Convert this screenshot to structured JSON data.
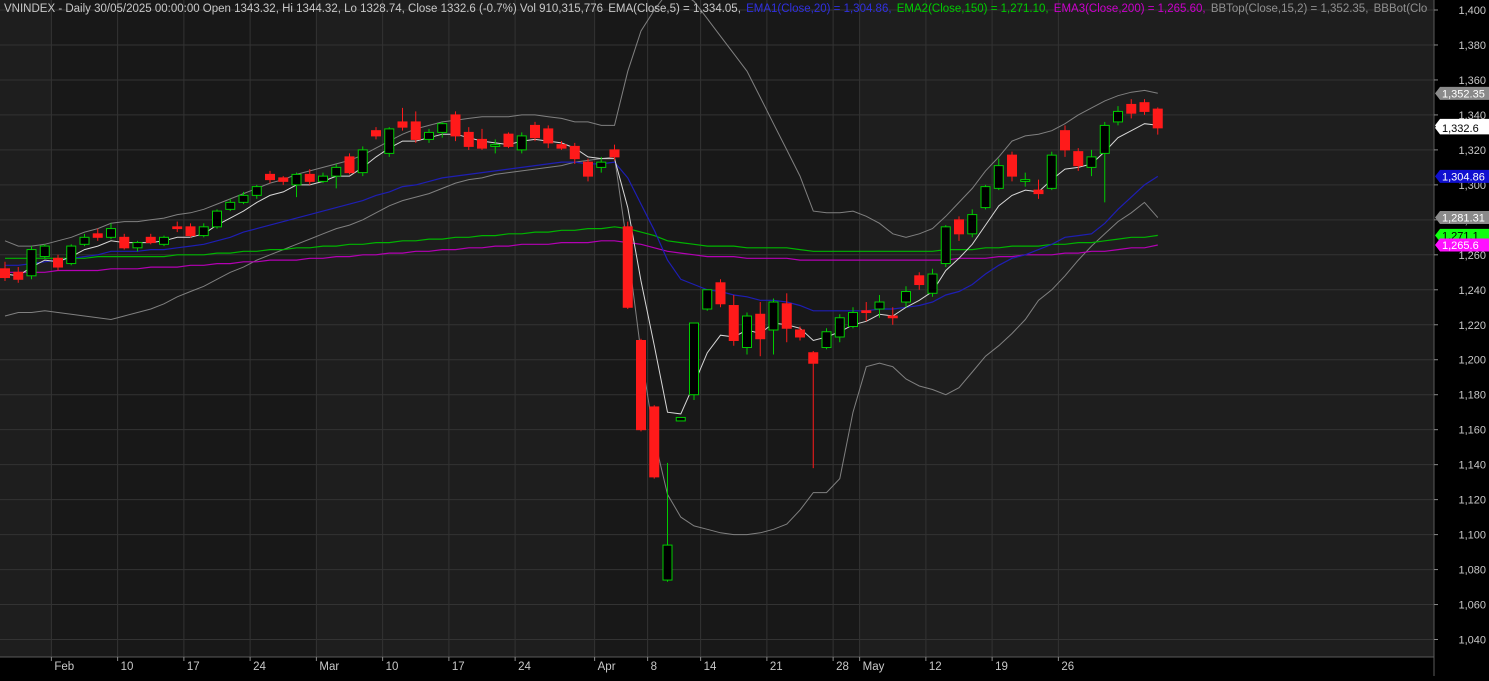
{
  "chart_data": {
    "type": "candlestick",
    "header": {
      "ticker_line": "VNINDEX - Daily 30/05/2025 00:00:00 Open 1343.32, Hi 1344.32, Lo 1328.74, Close 1332.6 (-0.7%) Vol 910,315,776",
      "ema": "EMA(Close,5) = 1,334.05,",
      "ema1": "EMA1(Close,20) = 1,304.86,",
      "ema2": "EMA2(Close,150) = 1,271.10,",
      "ema3": "EMA3(Close,200) = 1,265.60,",
      "bbtop": "BBTop(Close,15,2) = 1,352.35,",
      "bbbot": "BBBot(Clo"
    },
    "colors": {
      "background": "#000000",
      "panel_dark": "#181818",
      "panel_light": "#1e1e1e",
      "grid": "#333333",
      "up": "#00cc00",
      "down": "#ff1a1a",
      "ema": "#d8d8d8",
      "ema1": "#1e1eb4",
      "ema2": "#00b400",
      "ema3": "#b400b4",
      "bb": "#808080",
      "axis_text": "#c8c8c8"
    },
    "ylim": [
      1030,
      1400
    ],
    "y_ticks": [
      1040,
      1060,
      1080,
      1100,
      1120,
      1140,
      1160,
      1180,
      1200,
      1220,
      1240,
      1260,
      1280,
      1300,
      1320,
      1340,
      1360,
      1380,
      1400
    ],
    "y_tick_labels": [
      "1,040",
      "1,060",
      "1,080",
      "1,100",
      "1,120",
      "1,140",
      "1,160",
      "1,180",
      "1,200",
      "1,220",
      "1,240",
      "1,260",
      "1,280",
      "1,300",
      "1,320",
      "1,340",
      "1,360",
      "1,380",
      "1,400"
    ],
    "x_labels": [
      {
        "i": 4,
        "label": "Feb"
      },
      {
        "i": 9,
        "label": "10"
      },
      {
        "i": 14,
        "label": "17"
      },
      {
        "i": 19,
        "label": "24"
      },
      {
        "i": 24,
        "label": "Mar"
      },
      {
        "i": 29,
        "label": "10"
      },
      {
        "i": 34,
        "label": "17"
      },
      {
        "i": 39,
        "label": "24"
      },
      {
        "i": 45,
        "label": "Apr"
      },
      {
        "i": 49,
        "label": "8"
      },
      {
        "i": 53,
        "label": "14"
      },
      {
        "i": 58,
        "label": "21"
      },
      {
        "i": 63,
        "label": "28"
      },
      {
        "i": 65,
        "label": "May"
      },
      {
        "i": 70,
        "label": "12"
      },
      {
        "i": 75,
        "label": "19"
      },
      {
        "i": 80,
        "label": "26"
      }
    ],
    "period_shading_starts": [
      4,
      24,
      45,
      65
    ],
    "candles": [
      {
        "o": 1252,
        "h": 1256,
        "l": 1245,
        "c": 1247
      },
      {
        "o": 1250,
        "h": 1253,
        "l": 1244,
        "c": 1246
      },
      {
        "o": 1248,
        "h": 1265,
        "l": 1246,
        "c": 1263
      },
      {
        "o": 1259,
        "h": 1266,
        "l": 1258,
        "c": 1265
      },
      {
        "o": 1258,
        "h": 1260,
        "l": 1251,
        "c": 1253
      },
      {
        "o": 1255,
        "h": 1266,
        "l": 1254,
        "c": 1265
      },
      {
        "o": 1266,
        "h": 1272,
        "l": 1265,
        "c": 1270
      },
      {
        "o": 1272,
        "h": 1275,
        "l": 1268,
        "c": 1270
      },
      {
        "o": 1270,
        "h": 1278,
        "l": 1269,
        "c": 1275
      },
      {
        "o": 1270,
        "h": 1272,
        "l": 1263,
        "c": 1264
      },
      {
        "o": 1264,
        "h": 1268,
        "l": 1262,
        "c": 1267
      },
      {
        "o": 1270,
        "h": 1272,
        "l": 1266,
        "c": 1267
      },
      {
        "o": 1266,
        "h": 1271,
        "l": 1265,
        "c": 1270
      },
      {
        "o": 1276,
        "h": 1279,
        "l": 1273,
        "c": 1275
      },
      {
        "o": 1276,
        "h": 1278,
        "l": 1270,
        "c": 1271
      },
      {
        "o": 1271,
        "h": 1278,
        "l": 1270,
        "c": 1276
      },
      {
        "o": 1276,
        "h": 1286,
        "l": 1275,
        "c": 1285
      },
      {
        "o": 1286,
        "h": 1292,
        "l": 1285,
        "c": 1290
      },
      {
        "o": 1290,
        "h": 1296,
        "l": 1289,
        "c": 1294
      },
      {
        "o": 1294,
        "h": 1300,
        "l": 1292,
        "c": 1299
      },
      {
        "o": 1306,
        "h": 1308,
        "l": 1301,
        "c": 1303
      },
      {
        "o": 1304,
        "h": 1305,
        "l": 1300,
        "c": 1302
      },
      {
        "o": 1300,
        "h": 1307,
        "l": 1293,
        "c": 1306
      },
      {
        "o": 1306,
        "h": 1309,
        "l": 1300,
        "c": 1302
      },
      {
        "o": 1302,
        "h": 1307,
        "l": 1301,
        "c": 1305
      },
      {
        "o": 1305,
        "h": 1312,
        "l": 1298,
        "c": 1310
      },
      {
        "o": 1316,
        "h": 1318,
        "l": 1306,
        "c": 1307
      },
      {
        "o": 1307,
        "h": 1322,
        "l": 1305,
        "c": 1320
      },
      {
        "o": 1331,
        "h": 1333,
        "l": 1326,
        "c": 1328
      },
      {
        "o": 1318,
        "h": 1333,
        "l": 1316,
        "c": 1332
      },
      {
        "o": 1336,
        "h": 1344,
        "l": 1331,
        "c": 1333
      },
      {
        "o": 1336,
        "h": 1342,
        "l": 1324,
        "c": 1326
      },
      {
        "o": 1326,
        "h": 1332,
        "l": 1324,
        "c": 1330
      },
      {
        "o": 1330,
        "h": 1336,
        "l": 1327,
        "c": 1335
      },
      {
        "o": 1340,
        "h": 1342,
        "l": 1325,
        "c": 1328
      },
      {
        "o": 1330,
        "h": 1333,
        "l": 1320,
        "c": 1322
      },
      {
        "o": 1326,
        "h": 1332,
        "l": 1320,
        "c": 1321
      },
      {
        "o": 1322,
        "h": 1326,
        "l": 1318,
        "c": 1323
      },
      {
        "o": 1329,
        "h": 1330,
        "l": 1321,
        "c": 1322
      },
      {
        "o": 1320,
        "h": 1330,
        "l": 1318,
        "c": 1328
      },
      {
        "o": 1334,
        "h": 1336,
        "l": 1325,
        "c": 1327
      },
      {
        "o": 1332,
        "h": 1334,
        "l": 1321,
        "c": 1324
      },
      {
        "o": 1323,
        "h": 1325,
        "l": 1320,
        "c": 1321
      },
      {
        "o": 1322,
        "h": 1324,
        "l": 1312,
        "c": 1315
      },
      {
        "o": 1313,
        "h": 1315,
        "l": 1302,
        "c": 1305
      },
      {
        "o": 1310,
        "h": 1316,
        "l": 1307,
        "c": 1313
      },
      {
        "o": 1320,
        "h": 1323,
        "l": 1314,
        "c": 1316
      },
      {
        "o": 1276,
        "h": 1279,
        "l": 1229,
        "c": 1230
      },
      {
        "o": 1211,
        "h": 1212,
        "l": 1159,
        "c": 1160
      },
      {
        "o": 1173,
        "h": 1174,
        "l": 1132,
        "c": 1133
      },
      {
        "o": 1074,
        "h": 1141,
        "l": 1073,
        "c": 1094
      },
      {
        "o": 1165,
        "h": 1167,
        "l": 1165,
        "c": 1167
      },
      {
        "o": 1180,
        "h": 1221,
        "l": 1177,
        "c": 1221
      },
      {
        "o": 1229,
        "h": 1240,
        "l": 1228,
        "c": 1240
      },
      {
        "o": 1244,
        "h": 1246,
        "l": 1230,
        "c": 1232
      },
      {
        "o": 1231,
        "h": 1237,
        "l": 1208,
        "c": 1211
      },
      {
        "o": 1207,
        "h": 1227,
        "l": 1203,
        "c": 1225
      },
      {
        "o": 1226,
        "h": 1233,
        "l": 1202,
        "c": 1212
      },
      {
        "o": 1217,
        "h": 1235,
        "l": 1203,
        "c": 1233
      },
      {
        "o": 1232,
        "h": 1238,
        "l": 1210,
        "c": 1218
      },
      {
        "o": 1217,
        "h": 1219,
        "l": 1211,
        "c": 1213
      },
      {
        "o": 1204,
        "h": 1205,
        "l": 1138,
        "c": 1198
      },
      {
        "o": 1207,
        "h": 1218,
        "l": 1206,
        "c": 1216
      },
      {
        "o": 1213,
        "h": 1226,
        "l": 1210,
        "c": 1224
      },
      {
        "o": 1219,
        "h": 1230,
        "l": 1218,
        "c": 1227
      },
      {
        "o": 1228,
        "h": 1233,
        "l": 1222,
        "c": 1227
      },
      {
        "o": 1229,
        "h": 1237,
        "l": 1224,
        "c": 1233
      },
      {
        "o": 1225,
        "h": 1230,
        "l": 1220,
        "c": 1224
      },
      {
        "o": 1233,
        "h": 1242,
        "l": 1230,
        "c": 1239
      },
      {
        "o": 1248,
        "h": 1250,
        "l": 1240,
        "c": 1243
      },
      {
        "o": 1238,
        "h": 1252,
        "l": 1236,
        "c": 1249
      },
      {
        "o": 1255,
        "h": 1277,
        "l": 1253,
        "c": 1276
      },
      {
        "o": 1280,
        "h": 1282,
        "l": 1268,
        "c": 1272
      },
      {
        "o": 1272,
        "h": 1286,
        "l": 1270,
        "c": 1283
      },
      {
        "o": 1287,
        "h": 1300,
        "l": 1286,
        "c": 1299
      },
      {
        "o": 1298,
        "h": 1315,
        "l": 1297,
        "c": 1311
      },
      {
        "o": 1317,
        "h": 1319,
        "l": 1302,
        "c": 1305
      },
      {
        "o": 1302,
        "h": 1307,
        "l": 1299,
        "c": 1303
      },
      {
        "o": 1297,
        "h": 1303,
        "l": 1292,
        "c": 1295
      },
      {
        "o": 1298,
        "h": 1319,
        "l": 1297,
        "c": 1317
      },
      {
        "o": 1331,
        "h": 1334,
        "l": 1316,
        "c": 1320
      },
      {
        "o": 1319,
        "h": 1321,
        "l": 1308,
        "c": 1311
      },
      {
        "o": 1310,
        "h": 1320,
        "l": 1305,
        "c": 1316
      },
      {
        "o": 1318,
        "h": 1336,
        "l": 1290,
        "c": 1334
      },
      {
        "o": 1336,
        "h": 1345,
        "l": 1334,
        "c": 1342
      },
      {
        "o": 1346,
        "h": 1349,
        "l": 1338,
        "c": 1341
      },
      {
        "o": 1347,
        "h": 1349,
        "l": 1340,
        "c": 1342
      },
      {
        "o": 1343.32,
        "h": 1344.32,
        "l": 1328.74,
        "c": 1332.6
      }
    ],
    "lines": {
      "ema": [
        1249,
        1248,
        1253,
        1257,
        1256,
        1259,
        1263,
        1265,
        1268,
        1267,
        1267,
        1267,
        1268,
        1270,
        1270,
        1272,
        1277,
        1281,
        1285,
        1290,
        1294,
        1296,
        1300,
        1300,
        1302,
        1305,
        1305,
        1310,
        1316,
        1321,
        1325,
        1325,
        1327,
        1329,
        1329,
        1327,
        1325,
        1324,
        1323,
        1325,
        1326,
        1325,
        1324,
        1321,
        1316,
        1315,
        1315,
        1287,
        1245,
        1208,
        1170,
        1169,
        1186,
        1204,
        1214,
        1213,
        1217,
        1215,
        1221,
        1220,
        1218,
        1211,
        1213,
        1216,
        1220,
        1222,
        1226,
        1225,
        1230,
        1234,
        1239,
        1251,
        1258,
        1266,
        1277,
        1288,
        1294,
        1297,
        1296,
        1303,
        1309,
        1310,
        1312,
        1319,
        1327,
        1331,
        1335,
        1334.05
      ],
      "ema1": [
        1254,
        1254,
        1255,
        1256,
        1257,
        1258,
        1259,
        1260,
        1262,
        1262,
        1262,
        1263,
        1263,
        1264,
        1265,
        1266,
        1268,
        1270,
        1273,
        1275,
        1277,
        1279,
        1281,
        1283,
        1285,
        1287,
        1289,
        1291,
        1294,
        1296,
        1299,
        1300,
        1302,
        1304,
        1305,
        1306,
        1307,
        1308,
        1309,
        1310,
        1311,
        1312,
        1313,
        1313,
        1312,
        1312,
        1313,
        1304,
        1289,
        1274,
        1257,
        1246,
        1243,
        1240,
        1239,
        1237,
        1236,
        1234,
        1234,
        1233,
        1231,
        1228,
        1228,
        1228,
        1228,
        1228,
        1229,
        1229,
        1230,
        1231,
        1233,
        1237,
        1239,
        1243,
        1249,
        1254,
        1258,
        1260,
        1263,
        1266,
        1270,
        1271,
        1272,
        1278,
        1286,
        1293,
        1300,
        1304.86
      ],
      "ema2": [
        1258,
        1258,
        1258,
        1258,
        1258,
        1258,
        1258,
        1259,
        1259,
        1259,
        1259,
        1259,
        1259,
        1260,
        1260,
        1260,
        1261,
        1261,
        1262,
        1262,
        1263,
        1263,
        1264,
        1264,
        1265,
        1265,
        1266,
        1266,
        1267,
        1267,
        1268,
        1268,
        1269,
        1269,
        1270,
        1270,
        1271,
        1271,
        1272,
        1272,
        1273,
        1273,
        1274,
        1274,
        1275,
        1275,
        1276,
        1275,
        1273,
        1271,
        1268,
        1267,
        1266,
        1265,
        1265,
        1265,
        1264,
        1264,
        1264,
        1264,
        1263,
        1262,
        1262,
        1262,
        1262,
        1262,
        1262,
        1262,
        1262,
        1262,
        1262,
        1263,
        1263,
        1263,
        1264,
        1264,
        1265,
        1265,
        1265,
        1266,
        1266,
        1267,
        1267,
        1268,
        1269,
        1270,
        1270,
        1271.1
      ],
      "ema3": [
        1250,
        1250,
        1250,
        1250,
        1251,
        1251,
        1251,
        1251,
        1252,
        1252,
        1252,
        1253,
        1253,
        1253,
        1254,
        1254,
        1255,
        1255,
        1256,
        1256,
        1257,
        1257,
        1257,
        1258,
        1258,
        1259,
        1259,
        1260,
        1260,
        1261,
        1261,
        1262,
        1262,
        1263,
        1263,
        1264,
        1264,
        1265,
        1265,
        1266,
        1266,
        1266,
        1267,
        1267,
        1267,
        1268,
        1268,
        1267,
        1266,
        1264,
        1262,
        1261,
        1260,
        1259,
        1259,
        1259,
        1258,
        1258,
        1258,
        1258,
        1257,
        1257,
        1257,
        1257,
        1257,
        1257,
        1257,
        1257,
        1257,
        1257,
        1257,
        1257,
        1258,
        1258,
        1258,
        1259,
        1259,
        1260,
        1260,
        1260,
        1261,
        1261,
        1262,
        1262,
        1263,
        1264,
        1264,
        1265.6
      ],
      "bbtop": [
        1268,
        1265,
        1265,
        1266,
        1268,
        1270,
        1273,
        1275,
        1278,
        1279,
        1279,
        1280,
        1281,
        1283,
        1284,
        1286,
        1289,
        1292,
        1295,
        1298,
        1301,
        1303,
        1306,
        1308,
        1310,
        1312,
        1314,
        1317,
        1321,
        1325,
        1329,
        1332,
        1334,
        1336,
        1337,
        1338,
        1339,
        1339,
        1339,
        1340,
        1340,
        1339,
        1338,
        1336,
        1336,
        1334,
        1334,
        1365,
        1388,
        1400,
        1410,
        1410,
        1405,
        1395,
        1385,
        1375,
        1365,
        1350,
        1335,
        1320,
        1305,
        1285,
        1284,
        1284,
        1285,
        1282,
        1278,
        1272,
        1270,
        1272,
        1275,
        1282,
        1290,
        1298,
        1308,
        1316,
        1325,
        1328,
        1329,
        1331,
        1335,
        1340,
        1344,
        1348,
        1351,
        1353,
        1354,
        1352.35
      ],
      "bbbot": [
        1225,
        1227,
        1227,
        1228,
        1227,
        1226,
        1225,
        1224,
        1223,
        1225,
        1227,
        1229,
        1232,
        1236,
        1239,
        1242,
        1246,
        1250,
        1253,
        1257,
        1260,
        1263,
        1266,
        1269,
        1272,
        1275,
        1277,
        1280,
        1284,
        1288,
        1291,
        1293,
        1295,
        1298,
        1301,
        1303,
        1304,
        1306,
        1307,
        1308,
        1309,
        1310,
        1311,
        1313,
        1314,
        1315,
        1316,
        1263,
        1204,
        1155,
        1123,
        1110,
        1105,
        1103,
        1101,
        1100,
        1100,
        1101,
        1103,
        1106,
        1114,
        1124,
        1124,
        1132,
        1170,
        1196,
        1198,
        1196,
        1189,
        1185,
        1183,
        1180,
        1184,
        1193,
        1202,
        1208,
        1215,
        1223,
        1234,
        1240,
        1248,
        1257,
        1265,
        1272,
        1279,
        1284,
        1290,
        1281.3
      ]
    },
    "price_labels": [
      {
        "text": "1,352.35",
        "v": 1352.35,
        "bg": "#8a8a8a",
        "fg": "#ffffff"
      },
      {
        "text": "1,334.05",
        "v": 1334.05,
        "bg": "#ffffff",
        "fg": "#000000"
      },
      {
        "text": "1,332.6",
        "v": 1332.6,
        "bg": "#ffffff",
        "fg": "#000000"
      },
      {
        "text": "1,304.86",
        "v": 1304.86,
        "bg": "#1010d0",
        "fg": "#ffffff"
      },
      {
        "text": "1,281.31",
        "v": 1281.31,
        "bg": "#8a8a8a",
        "fg": "#ffffff"
      },
      {
        "text": "1,271.1",
        "v": 1271.1,
        "bg": "#10ff10",
        "fg": "#000000"
      },
      {
        "text": "1,265.6",
        "v": 1265.6,
        "bg": "#ff10ff",
        "fg": "#ffffff"
      }
    ]
  }
}
